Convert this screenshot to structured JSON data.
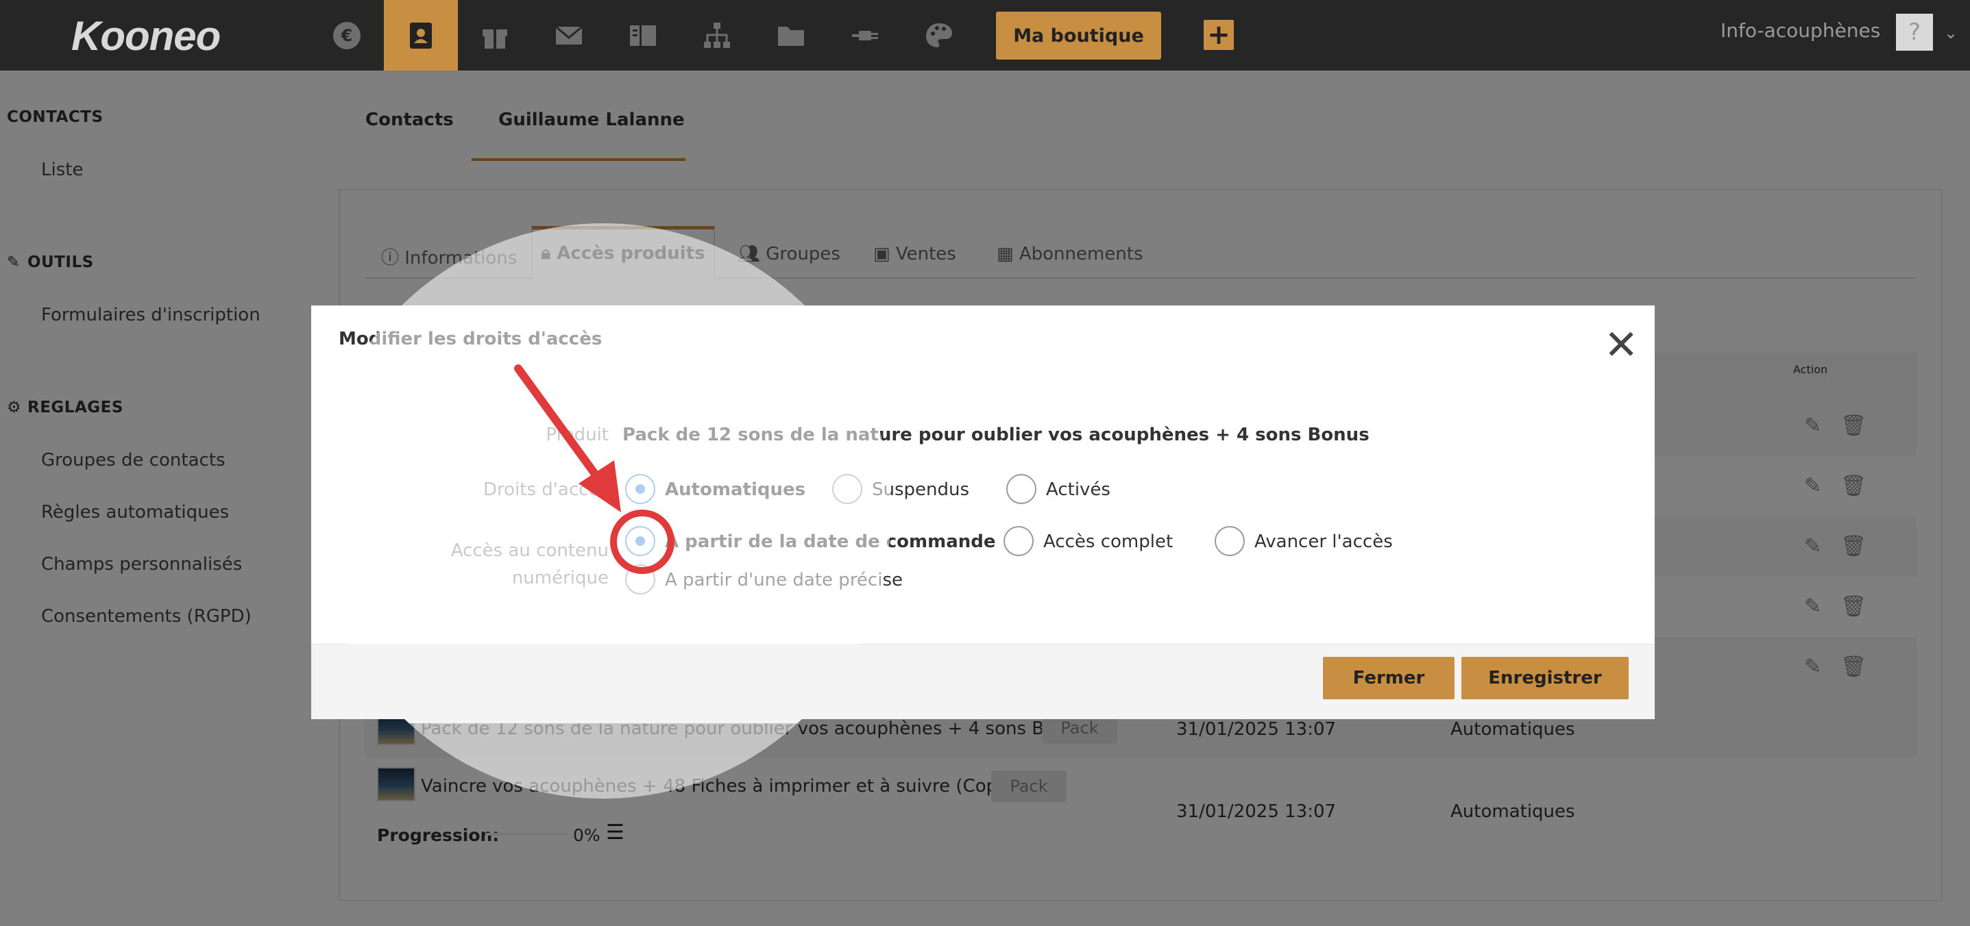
{
  "header": {
    "logo": "Kooneo",
    "shop_button": "Ma boutique",
    "plus_button": "+",
    "user_name": "Info-acouphènes",
    "avatar_glyph": "?",
    "caret": "⌄"
  },
  "sidebar": {
    "sections": [
      {
        "title": "CONTACTS",
        "icon": "",
        "items": [
          "Liste"
        ]
      },
      {
        "title": "OUTILS",
        "icon": "pencil-icon",
        "items": [
          "Formulaires d'inscription"
        ]
      },
      {
        "title": "REGLAGES",
        "icon": "gear-icon",
        "items": [
          "Groupes de contacts",
          "Règles automatiques",
          "Champs personnalisés",
          "Consentements (RGPD)"
        ]
      }
    ]
  },
  "main": {
    "tabs": [
      "Contacts",
      "Guillaume Lalanne"
    ],
    "subtabs": [
      "Informations",
      "Accès produits",
      "Groupes",
      "Ventes",
      "Abonnements"
    ],
    "table": {
      "action_header": "Action",
      "rows": [
        {
          "title": "Pack de 12 sons de la nature pour oublier vos acouphènes + 4 sons Bonus",
          "badge": "Pack",
          "date": "31/01/2025 13:07",
          "status": "Automatiques"
        },
        {
          "title": "Vaincre vos acouphènes + 48 Fiches à imprimer et à suivre (Copie)",
          "badge": "Pack",
          "date": "31/01/2025 13:07",
          "status": "Automatiques",
          "progress_label": "Progression:",
          "progress_value": "0%"
        }
      ]
    }
  },
  "modal": {
    "title": "Modifier les droits d'accès",
    "close": "✕",
    "product_label": "Produit",
    "product_value": "Pack de 12 sons de la nature pour oublier vos acouphènes + 4 sons Bonus",
    "rights_label": "Droits d'accès",
    "rights_options": [
      "Automatiques",
      "Suspendus",
      "Activés"
    ],
    "rights_selected": "Automatiques",
    "access_label_line1": "Accès au contenu",
    "access_label_line2": "numérique",
    "access_options": [
      "A partir de la date de commande",
      "Accès complet",
      "Avancer l'accès",
      "A partir d'une date précise"
    ],
    "access_selected": "A partir de la date de commande",
    "close_button": "Fermer",
    "save_button": "Enregistrer"
  },
  "colors": {
    "accent": "#c88e41",
    "topbar": "#262626",
    "radio_selected": "#4a90e2",
    "annotation": "#e03a3a"
  }
}
